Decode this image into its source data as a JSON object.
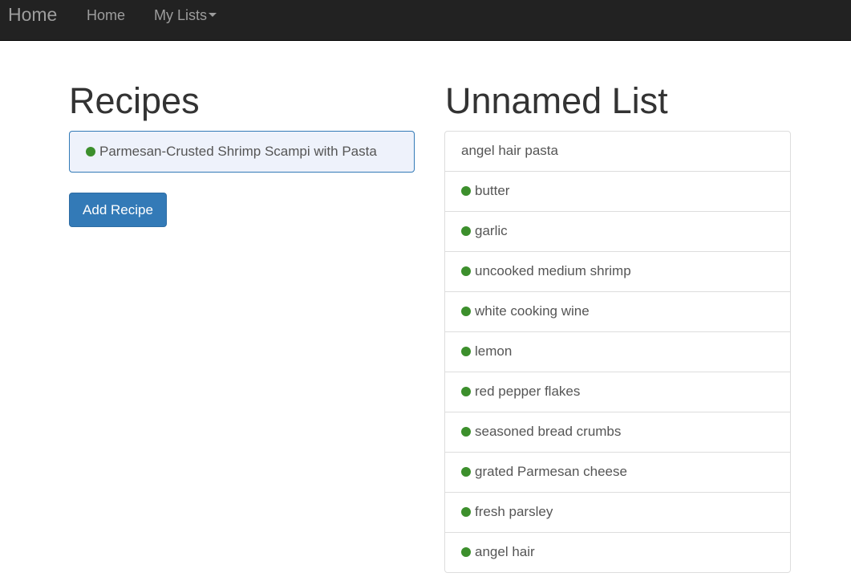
{
  "navbar": {
    "brand": "Home",
    "links": [
      {
        "label": "Home"
      },
      {
        "label": "My Lists"
      }
    ]
  },
  "recipes": {
    "title": "Recipes",
    "items": [
      {
        "label": "Parmesan-Crusted Shrimp Scampi with Pasta",
        "status": "green-dot"
      }
    ],
    "add_button": "Add Recipe"
  },
  "list": {
    "title": "Unnamed List",
    "items": [
      {
        "label": "angel hair pasta",
        "has_dot": false
      },
      {
        "label": "butter",
        "has_dot": true
      },
      {
        "label": "garlic",
        "has_dot": true
      },
      {
        "label": "uncooked medium shrimp",
        "has_dot": true
      },
      {
        "label": "white cooking wine",
        "has_dot": true
      },
      {
        "label": "lemon",
        "has_dot": true
      },
      {
        "label": "red pepper flakes",
        "has_dot": true
      },
      {
        "label": "seasoned bread crumbs",
        "has_dot": true
      },
      {
        "label": "grated Parmesan cheese",
        "has_dot": true
      },
      {
        "label": "fresh parsley",
        "has_dot": true
      },
      {
        "label": "angel hair",
        "has_dot": true
      }
    ]
  },
  "colors": {
    "navbar_bg": "#222222",
    "nav_text": "#9d9d9d",
    "primary": "#337ab7",
    "dot_green": "#3c8f2c",
    "selected_bg": "#eef2fb"
  }
}
